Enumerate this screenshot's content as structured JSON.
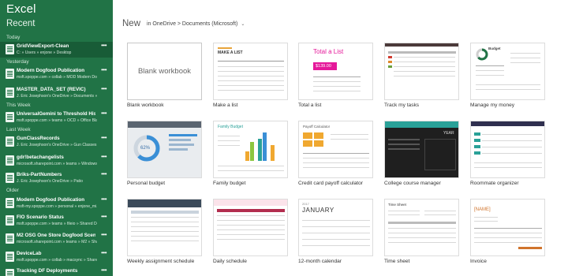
{
  "app": {
    "title": "Excel",
    "recent_title": "Recent"
  },
  "groups": {
    "today": "Today",
    "yesterday": "Yesterday",
    "this_week": "This Week",
    "last_week": "Last Week",
    "older": "Older"
  },
  "recent": [
    {
      "name": "GridViewExport-Clean",
      "path": "C: » Users » enjone » Desktop"
    },
    {
      "name": "Modern Dogfood Publication",
      "path": "msft.spoppe.com » collab » MOD Modern Do..."
    },
    {
      "name": "MASTER_DATA_SET (REVIC)",
      "path": "J. Eric Josephson's OneDrive » Documents » Mi..."
    },
    {
      "name": "UniversalGemini to Threshold History",
      "path": "msft.spoppe.com » teams » OCD » Office Bla..."
    },
    {
      "name": "GunClassRecords",
      "path": "J. Eric Josephson's OneDrive » Gun Classes"
    },
    {
      "name": "gdr!betachangelists",
      "path": "microsoft.sharepoint.com » teams » Windows..."
    },
    {
      "name": "Briks-PartNumbers",
      "path": "J. Eric Josephson's OneDrive » Patio"
    },
    {
      "name": "Modern Dogfood Publication",
      "path": "msft-my.spoppe.com » personal » enjone_mi..."
    },
    {
      "name": "FIO Scenario Status",
      "path": "msft.spoppe.com » teams » fileio » Shared Do..."
    },
    {
      "name": "M2 OSG One Store Dogfood Scenario...",
      "path": "microsoft.sharepoint.com » teams » M2 » Sha..."
    },
    {
      "name": "DeviceLab",
      "path": "msft.spoppe.com » collab » macsync » Shared..."
    },
    {
      "name": "Tracking DF Deployments",
      "path": ""
    }
  ],
  "more_glyph": "•••",
  "header": {
    "new_label": "New",
    "location": "in OneDrive > Documents (Microsoft)",
    "chevron": "⌄"
  },
  "templates": [
    {
      "label": "Blank workbook",
      "thumb_text": "Blank workbook"
    },
    {
      "label": "Make a list",
      "thumb_text": "MAKE A LIST"
    },
    {
      "label": "Total a list",
      "thumb_text": "Total a List",
      "amount": "$139.00"
    },
    {
      "label": "Track my tasks"
    },
    {
      "label": "Manage my money",
      "thumb_text": "Budget"
    },
    {
      "label": "Personal budget",
      "thumb_text": "62%"
    },
    {
      "label": "Family budget",
      "thumb_text": "Family Budget"
    },
    {
      "label": "Credit card payoff calculator",
      "thumb_text": "Payoff Calculator"
    },
    {
      "label": "College course manager",
      "thumb_text": "YEAR"
    },
    {
      "label": "Roommate organizer"
    },
    {
      "label": "Weekly assignment schedule"
    },
    {
      "label": "Daily schedule"
    },
    {
      "label": "12-month calendar",
      "thumb_text": "JANUARY",
      "year": "2017"
    },
    {
      "label": "Time sheet",
      "thumb_text": "Time Sheet"
    },
    {
      "label": "Invoice",
      "thumb_text": "[NAME]"
    }
  ],
  "colors": {
    "sidebar": "#217346",
    "selected": "#185c37",
    "magenta": "#e5199a",
    "teal": "#2aa198"
  }
}
